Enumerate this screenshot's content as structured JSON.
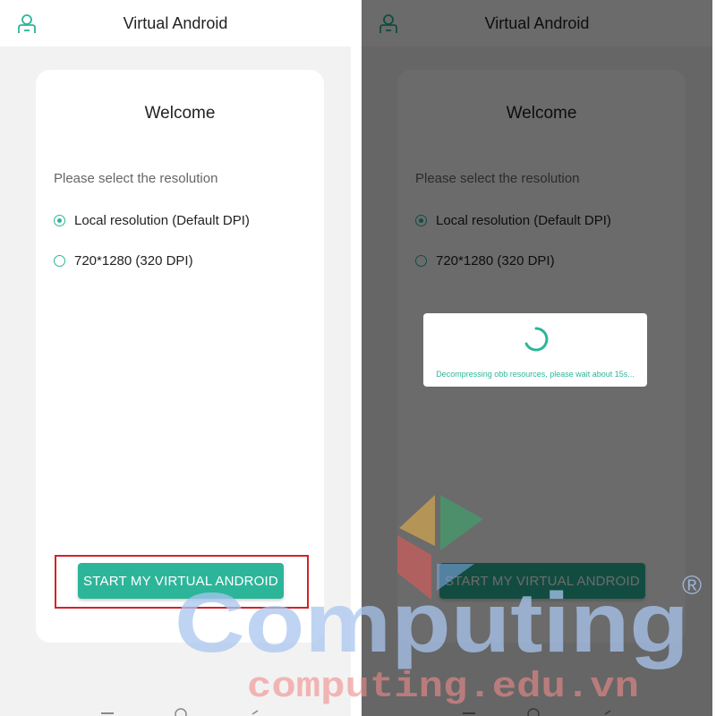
{
  "app": {
    "title": "Virtual Android",
    "icon": "user-icon"
  },
  "card": {
    "welcome": "Welcome",
    "prompt": "Please select the resolution",
    "options": [
      {
        "label": "Local resolution (Default DPI)",
        "checked": true
      },
      {
        "label": "720*1280 (320 DPI)",
        "checked": false
      }
    ],
    "start_button": "START MY VIRTUAL ANDROID"
  },
  "dialog": {
    "message": "Decompressing obb resources, please wait about 15s..."
  },
  "watermark": {
    "brand": "Computing",
    "registered": "®",
    "url": "computing.edu.vn"
  },
  "colors": {
    "accent": "#2db59a",
    "highlight": "#d2232a",
    "brand_blue": "#a9c6ef",
    "brand_red": "#f08a8a"
  }
}
